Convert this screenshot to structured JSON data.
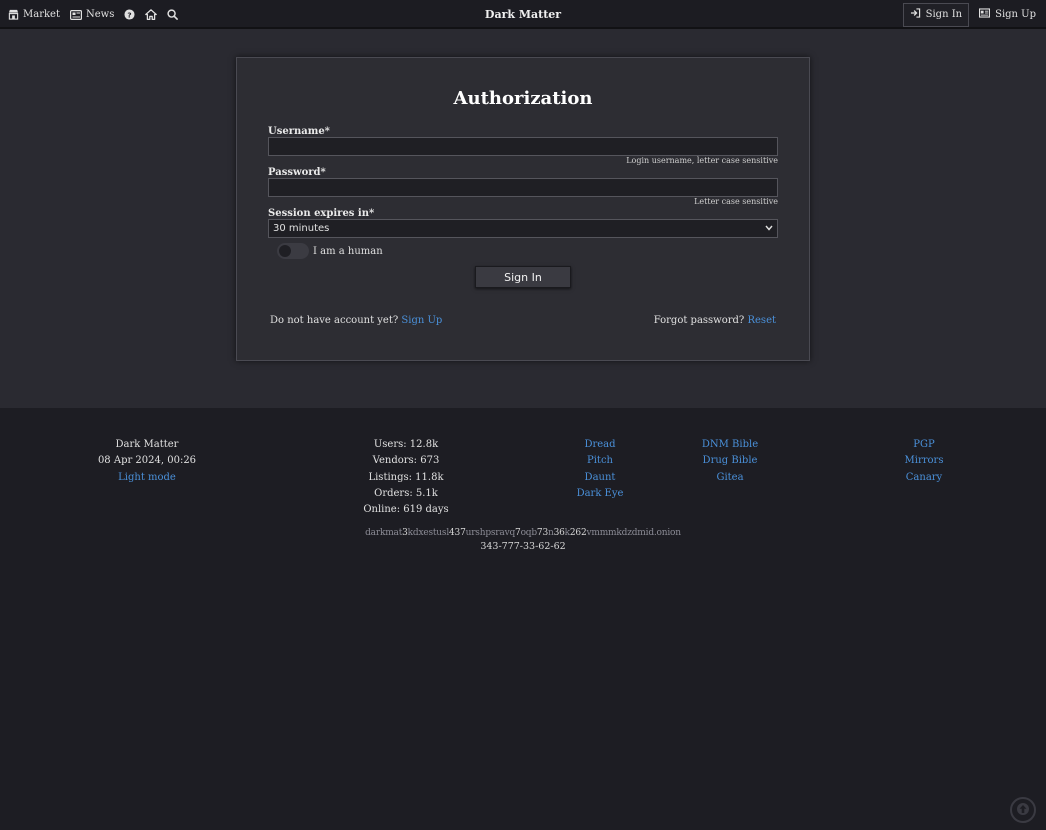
{
  "navbar": {
    "brand": "Dark Matter",
    "market_label": "Market",
    "news_label": "News",
    "signin_label": "Sign In",
    "signup_label": "Sign Up"
  },
  "auth": {
    "title": "Authorization",
    "username_label": "Username*",
    "username_hint": "Login username, letter case sensitive",
    "password_label": "Password*",
    "password_hint": "Letter case sensitive",
    "session_label": "Session expires in*",
    "session_value": "30 minutes",
    "human_label": "I am a human",
    "human_checked": false,
    "submit_label": "Sign In",
    "no_account_text": "Do not have account yet?",
    "signup_link": "Sign Up",
    "forgot_text": "Forgot password?",
    "reset_link": "Reset"
  },
  "footer": {
    "site": {
      "name": "Dark Matter",
      "datetime": "08 Apr 2024, 00:26",
      "theme_link": "Light mode"
    },
    "stats": [
      "Users: 12.8k",
      "Vendors: 673",
      "Listings: 11.8k",
      "Orders: 5.1k",
      "Online: 619 days"
    ],
    "links_col1": [
      "Dread",
      "Pitch",
      "Daunt",
      "Dark Eye"
    ],
    "links_col2": [
      "DNM Bible",
      "Drug Bible",
      "Gitea"
    ],
    "links_col3": [
      "PGP",
      "Mirrors",
      "Canary"
    ],
    "onion_segments": [
      {
        "text": "darkmat",
        "hl": false
      },
      {
        "text": "3",
        "hl": true
      },
      {
        "text": "kdxestusl",
        "hl": false
      },
      {
        "text": "437",
        "hl": true
      },
      {
        "text": "urshpsravq",
        "hl": false
      },
      {
        "text": "7",
        "hl": true
      },
      {
        "text": "oqb",
        "hl": false
      },
      {
        "text": "7",
        "hl": true
      },
      {
        "text": "3",
        "hl": true
      },
      {
        "text": "n",
        "hl": false
      },
      {
        "text": "36",
        "hl": true
      },
      {
        "text": "k",
        "hl": false
      },
      {
        "text": "262",
        "hl": true
      },
      {
        "text": "vmmmkdzdmid.onion",
        "hl": false
      }
    ],
    "phone": "343-777-33-62-62"
  },
  "colors": {
    "background": "#2a2a31",
    "card": "#2d2d33",
    "footer": "#1d1d23",
    "link": "#4a90d9"
  },
  "icons": {
    "market": "store-icon",
    "news": "newspaper-icon",
    "help": "question-circle-icon",
    "home": "home-icon",
    "search": "search-icon",
    "signin": "sign-in-icon",
    "signup": "id-card-icon",
    "scroll_top": "arrow-up-circle-icon",
    "select_chevron": "chevron-down-icon"
  }
}
